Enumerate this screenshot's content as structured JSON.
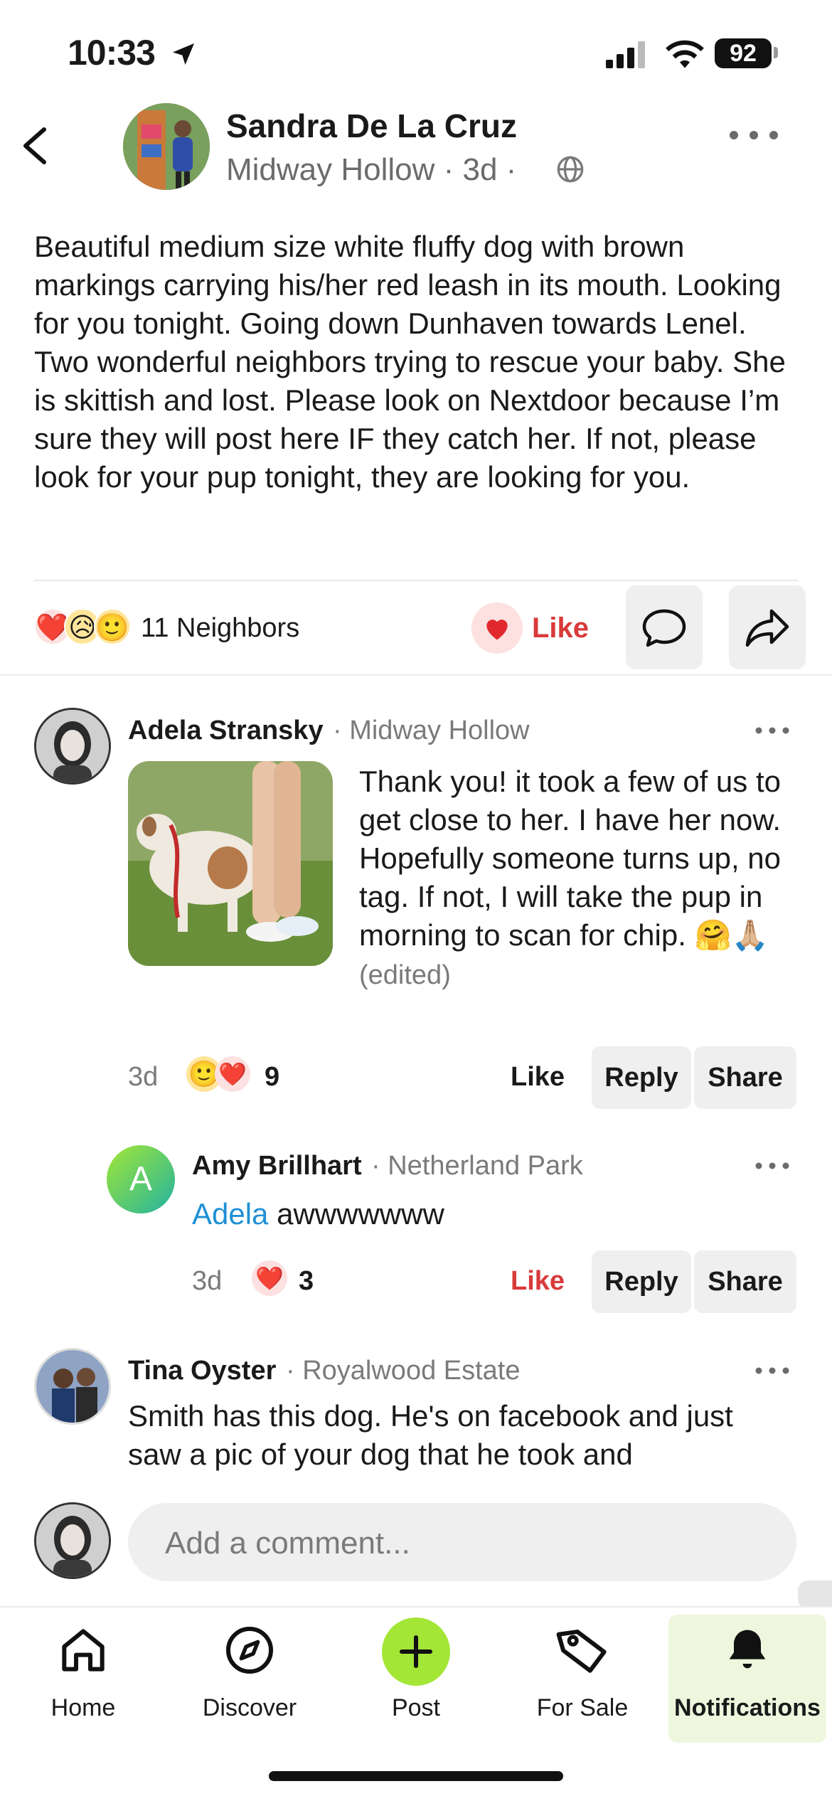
{
  "status_bar": {
    "time": "10:33",
    "battery": "92"
  },
  "post": {
    "author": "Sandra De La Cruz",
    "meta": "Midway Hollow · 3d ·",
    "body": "Beautiful medium size white fluffy dog with brown markings carrying his/her red leash in its mouth. Looking for you tonight. Going down Dunhaven towards Lenel. Two wonderful neighbors trying to rescue your baby. She is skittish and lost. Please look on Nextdoor because I’m sure they will post here IF they catch her. If not, please look for your pup tonight, they are looking for you.",
    "reaction_emojis": [
      "❤️",
      "😥",
      "🙂"
    ],
    "reaction_count": "11 Neighbors",
    "like_label": "Like"
  },
  "comments": [
    {
      "name": "Adela Stransky",
      "location": "· Midway Hollow",
      "text": "Thank you! it took a few of us to get close to her. I have her now. Hopefully someone turns up, no tag. If not, I will take the pup in morning to scan for chip. 🤗🙏🏼",
      "edited": "(edited)",
      "time": "3d",
      "reactions": [
        "🙂",
        "❤️"
      ],
      "count": "9",
      "like": "Like",
      "reply": "Reply",
      "share": "Share"
    },
    {
      "name": "Amy Brillhart",
      "avatar_letter": "A",
      "location": "· Netherland Park",
      "mention": "Adela",
      "text": "awwwwwww",
      "time": "3d",
      "reactions": [
        "❤️"
      ],
      "count": "3",
      "like": "Like",
      "reply": "Reply",
      "share": "Share"
    },
    {
      "name": "Tina Oyster",
      "location": "· Royalwood Estate",
      "text": "Smith has this dog.  He's on facebook and just saw a pic of your dog that he took and"
    }
  ],
  "add_comment": {
    "placeholder": "Add a comment..."
  },
  "nav": [
    {
      "label": "Home"
    },
    {
      "label": "Discover"
    },
    {
      "label": "Post"
    },
    {
      "label": "For Sale"
    },
    {
      "label": "Notifications"
    }
  ],
  "colors": {
    "accent_red": "#d93a3a",
    "accent_green": "#a3e635",
    "mention_blue": "#1e90d6",
    "active_nav_bg": "#eef7de"
  }
}
